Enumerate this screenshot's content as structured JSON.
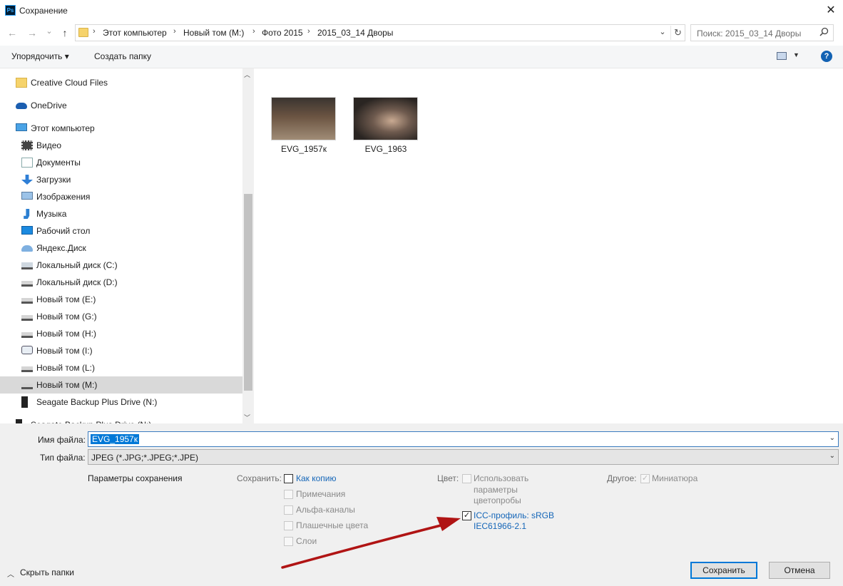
{
  "window": {
    "title": "Сохранение",
    "app_badge": "Ps",
    "close_glyph": "✕"
  },
  "nav": {
    "back_glyph": "←",
    "forward_glyph": "→",
    "recent_glyph": "⌄",
    "up_glyph": "↑"
  },
  "address": {
    "crumbs": [
      "Этот компьютер",
      "Новый том (M:)",
      "Фото 2015",
      "2015_03_14 Дворы"
    ],
    "separator": "›",
    "dropdown_glyph": "⌄",
    "refresh_glyph": "↻"
  },
  "search": {
    "placeholder": "Поиск: 2015_03_14 Дворы",
    "icon": "search-icon"
  },
  "toolbar": {
    "organize_label": "Упорядочить ▾",
    "new_folder_label": "Создать папку",
    "help_glyph": "?"
  },
  "sidebar": {
    "items": [
      {
        "label": "Creative Cloud Files",
        "icon": "cloud-files-icon"
      },
      {
        "label": "OneDrive",
        "icon": "onedrive-icon"
      },
      {
        "label": "Этот компьютер",
        "icon": "computer-icon"
      },
      {
        "label": "Видео",
        "icon": "video-icon"
      },
      {
        "label": "Документы",
        "icon": "documents-icon"
      },
      {
        "label": "Загрузки",
        "icon": "downloads-icon"
      },
      {
        "label": "Изображения",
        "icon": "images-icon"
      },
      {
        "label": "Музыка",
        "icon": "music-icon"
      },
      {
        "label": "Рабочий стол",
        "icon": "desktop-icon"
      },
      {
        "label": "Яндекс.Диск",
        "icon": "yandex-disk-icon"
      },
      {
        "label": "Локальный диск (C:)",
        "icon": "windows-drive-icon"
      },
      {
        "label": "Локальный диск (D:)",
        "icon": "drive-icon"
      },
      {
        "label": "Новый том (E:)",
        "icon": "drive-icon"
      },
      {
        "label": "Новый том (G:)",
        "icon": "drive-icon"
      },
      {
        "label": "Новый том (H:)",
        "icon": "drive-icon"
      },
      {
        "label": "Новый том (I:)",
        "icon": "optical-drive-icon"
      },
      {
        "label": "Новый том (L:)",
        "icon": "drive-icon"
      },
      {
        "label": "Новый том (M:)",
        "icon": "drive-icon"
      },
      {
        "label": "Seagate Backup Plus Drive (N:)",
        "icon": "external-drive-icon"
      },
      {
        "label": "Seagate Backup Plus Drive (N:)",
        "icon": "external-drive-icon"
      }
    ],
    "selected": "Новый том (M:)"
  },
  "files": [
    {
      "name": "EVG_1957к",
      "thumb_colors": [
        "#6b5442",
        "#3a3430",
        "#a08c76"
      ]
    },
    {
      "name": "EVG_1963",
      "thumb_colors": [
        "#2a2522",
        "#c9aa92",
        "#6e5a4e"
      ]
    }
  ],
  "form": {
    "filename_label": "Имя файла:",
    "filename_value": "EVG_1957к",
    "filetype_label": "Тип файла:",
    "filetype_value": "JPEG (*.JPG;*.JPEG;*.JPE)",
    "save_options_label": "Параметры сохранения",
    "save_group_label": "Сохранить:",
    "save_options": [
      {
        "label": "Как копию",
        "checked": false,
        "enabled": true
      },
      {
        "label": "Примечания",
        "checked": false,
        "enabled": false
      },
      {
        "label": "Альфа-каналы",
        "checked": false,
        "enabled": false
      },
      {
        "label": "Плашечные цвета",
        "checked": false,
        "enabled": false
      },
      {
        "label": "Слои",
        "checked": false,
        "enabled": false
      }
    ],
    "color_label": "Цвет:",
    "proof_line1": "Использовать",
    "proof_line2": "параметры",
    "proof_line3": "цветопробы",
    "icc_line1": "ICC-профиль:  sRGB",
    "icc_line2": "IEC61966-2.1",
    "icc_checked": true,
    "other_label": "Другое:",
    "thumbnail_label": "Миниатюра",
    "thumbnail_checked": true
  },
  "buttons": {
    "save": "Сохранить",
    "cancel": "Отмена",
    "hide_folders": "Скрыть папки"
  },
  "colors": {
    "accent": "#0078d7",
    "link": "#1566b8",
    "annotation_arrow": "#b01414"
  }
}
